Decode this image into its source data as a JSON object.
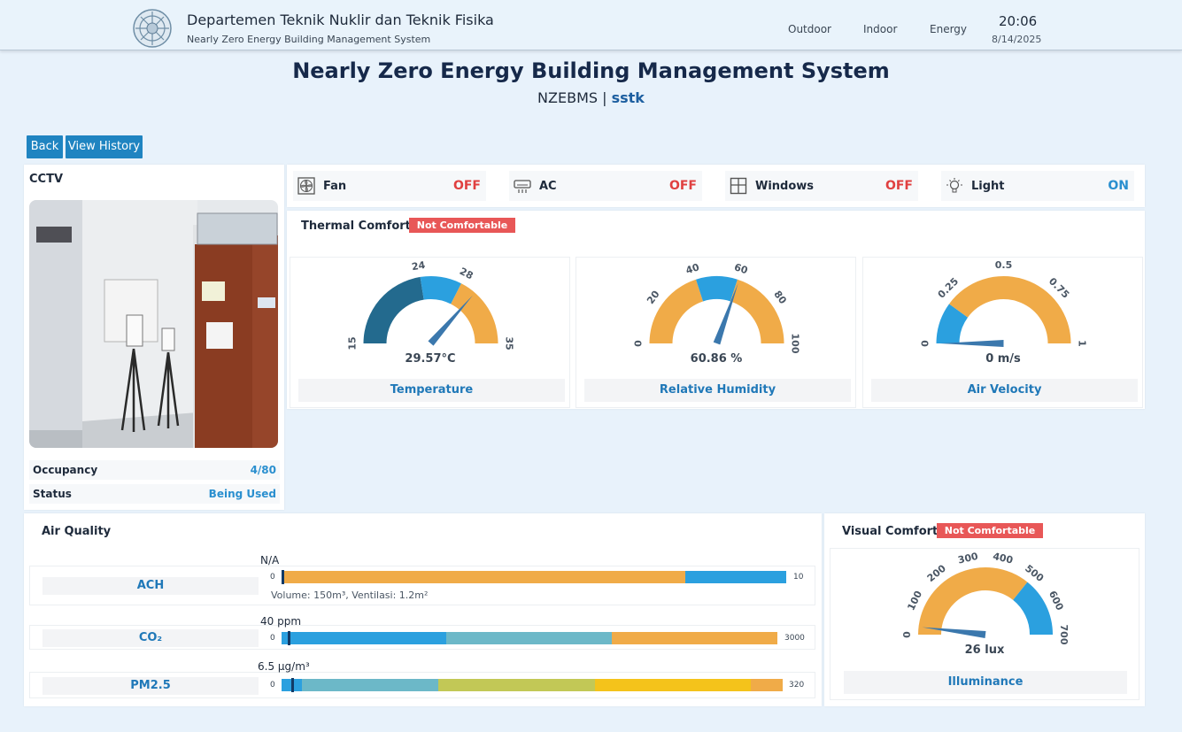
{
  "header": {
    "org_title": "Departemen Teknik Nuklir dan Teknik Fisika",
    "org_subtitle": "Nearly Zero Energy Building Management System",
    "nav": [
      "Outdoor",
      "Indoor",
      "Energy"
    ],
    "time": "20:06",
    "date": "8/14/2025"
  },
  "page": {
    "title": "Nearly Zero Energy Building Management System",
    "subtitle_prefix": "NZEBMS | ",
    "subtitle_room": "sstk"
  },
  "buttons": {
    "back": "Back",
    "history": "View History"
  },
  "cctv": {
    "title": "CCTV",
    "occupancy_label": "Occupancy",
    "occupancy_value": "4/80",
    "status_label": "Status",
    "status_value": "Being Used"
  },
  "devices": [
    {
      "name": "Fan",
      "state": "OFF",
      "icon": "fan-icon"
    },
    {
      "name": "AC",
      "state": "OFF",
      "icon": "ac-icon"
    },
    {
      "name": "Windows",
      "state": "OFF",
      "icon": "window-icon"
    },
    {
      "name": "Light",
      "state": "ON",
      "icon": "lightbulb-icon"
    }
  ],
  "thermal": {
    "title": "Thermal Comfort",
    "status": "Not Comfortable",
    "gauges": [
      {
        "label": "Temperature",
        "display": "29.57°C",
        "value": 29.57,
        "min": 15,
        "max": 35,
        "ticks": [
          "15",
          "24",
          "28",
          "35"
        ],
        "tick_values": [
          15,
          24,
          28,
          35
        ],
        "bands": [
          {
            "from": 15,
            "to": 24,
            "color": "#236a8e"
          },
          {
            "from": 24,
            "to": 28,
            "color": "#2ba0df"
          },
          {
            "from": 28,
            "to": 35,
            "color": "#f0ab48"
          }
        ]
      },
      {
        "label": "Relative Humidity",
        "display": "60.86 %",
        "value": 60.86,
        "min": 0,
        "max": 100,
        "ticks": [
          "0",
          "20",
          "40",
          "60",
          "80",
          "100"
        ],
        "tick_values": [
          0,
          20,
          40,
          60,
          80,
          100
        ],
        "bands": [
          {
            "from": 0,
            "to": 40,
            "color": "#f0ab48"
          },
          {
            "from": 40,
            "to": 60,
            "color": "#2ba0df"
          },
          {
            "from": 60,
            "to": 100,
            "color": "#f0ab48"
          }
        ]
      },
      {
        "label": "Air Velocity",
        "display": "0 m/s",
        "value": 0,
        "min": 0,
        "max": 1,
        "ticks": [
          "0",
          "0.25",
          "0.5",
          "0.75",
          "1"
        ],
        "tick_values": [
          0,
          0.25,
          0.5,
          0.75,
          1
        ],
        "bands": [
          {
            "from": 0,
            "to": 0.2,
            "color": "#2ba0df"
          },
          {
            "from": 0.2,
            "to": 1,
            "color": "#f0ab48"
          }
        ]
      }
    ]
  },
  "air_quality": {
    "title": "Air Quality",
    "rows": [
      {
        "name": "ACH",
        "value": "N/A",
        "note": "Volume: 150m³, Ventilasi: 1.2m²",
        "min": "0",
        "max": "10",
        "marker": 0,
        "segments": [
          {
            "frac": 0.8,
            "color": "#f0ab48"
          },
          {
            "frac": 0.2,
            "color": "#2ba0df"
          }
        ]
      },
      {
        "name": "CO₂",
        "value": "40 ppm",
        "note": "",
        "min": "0",
        "max": "3000",
        "marker": 0.013,
        "segments": [
          {
            "frac": 0.333,
            "color": "#2ba0df"
          },
          {
            "frac": 0.333,
            "color": "#6cb8c8"
          },
          {
            "frac": 0.334,
            "color": "#f0ab48"
          }
        ]
      },
      {
        "name": "PM2.5",
        "value": "6.5 μg/m³",
        "note": "",
        "min": "0",
        "max": "320",
        "marker": 0.02,
        "segments": [
          {
            "frac": 0.04,
            "color": "#2ba0df"
          },
          {
            "frac": 0.273,
            "color": "#6cb8c8"
          },
          {
            "frac": 0.313,
            "color": "#c2c856"
          },
          {
            "frac": 0.31,
            "color": "#f4c31b"
          },
          {
            "frac": 0.064,
            "color": "#f0ab48"
          }
        ]
      }
    ]
  },
  "visual": {
    "title": "Visual Comfort",
    "status": "Not Comfortable",
    "gauge": {
      "label": "Illuminance",
      "display": "26 lux",
      "value": 26,
      "min": 0,
      "max": 700,
      "ticks": [
        "0",
        "100",
        "200",
        "300",
        "400",
        "500",
        "600",
        "700"
      ],
      "tick_values": [
        0,
        100,
        200,
        300,
        400,
        500,
        600,
        700
      ],
      "bands": [
        {
          "from": 0,
          "to": 500,
          "color": "#f0ab48"
        },
        {
          "from": 500,
          "to": 700,
          "color": "#2ba0df"
        }
      ]
    }
  }
}
